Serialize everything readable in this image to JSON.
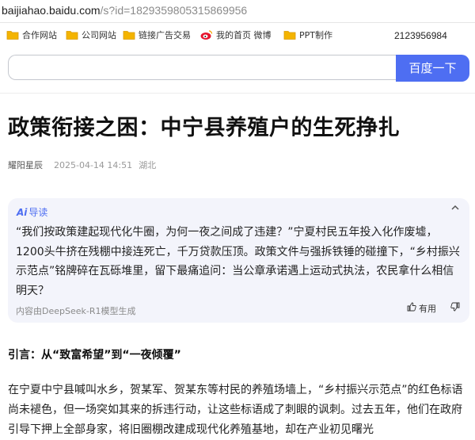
{
  "browser": {
    "url_host": "baijiahao.baidu.com",
    "url_path": "/s?id=1829359805315869956"
  },
  "bookmarks": {
    "items": [
      {
        "label": "合作网站",
        "icon": "folder-icon"
      },
      {
        "label": "公司网站",
        "icon": "folder-icon"
      },
      {
        "label": "链接广告交易",
        "icon": "folder-icon"
      },
      {
        "label": "我的首页 微博",
        "icon": "weibo-icon"
      },
      {
        "label": "PPT制作",
        "icon": "folder-icon"
      }
    ],
    "number": "2123956984"
  },
  "search": {
    "value": "",
    "button_label": "百度一下"
  },
  "article": {
    "title": "政策衔接之困：中宁县养殖户的生死挣扎",
    "author": "耀阳星辰",
    "date": "2025-04-14 14:51",
    "location": "湖北"
  },
  "ai_summary": {
    "badge_ai": "Ai",
    "badge_label": "导读",
    "text": "“我们按政策建起现代化牛圈，为何一夜之间成了违建？”宁夏村民五年投入化作废墟，1200头牛挤在残棚中接连死亡，千万贷款压顶。政策文件与强拆铁锤的碰撞下，“乡村振兴示范点”铭牌碎在瓦砾堆里，留下最痛追问：当公章承诺遇上运动式执法，农民拿什么相信明天？",
    "source": "内容由DeepSeek-R1模型生成",
    "useful_label": "有用"
  },
  "body": {
    "intro": "引言：从“致富希望”到“一夜倾覆”",
    "paragraph": "在宁夏中宁县喊叫水乡，贺某军、贺某东等村民的养殖场墙上，“乡村振兴示范点”的红色标语尚未褪色，但一场突如其来的拆违行动，让这些标语成了刺眼的讽刺。过去五年，他们在政府引导下押上全部身家，将旧圈棚改建成现代化养殖基地，却在产业初见曙光"
  },
  "colors": {
    "accent": "#4e6ef2",
    "folder": "#f4b400",
    "card_bg": "#f3f4fb"
  }
}
